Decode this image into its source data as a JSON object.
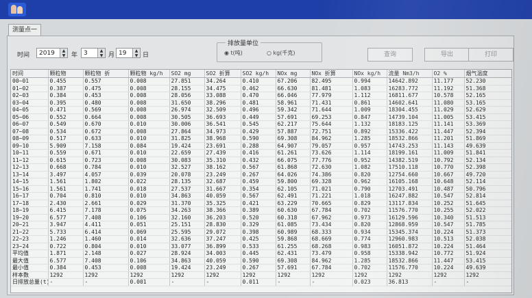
{
  "tab_label": "测量点一",
  "controls": {
    "time_label": "时间",
    "year": "2019",
    "year_unit": "年",
    "month": "3",
    "month_unit": "月",
    "day": "19",
    "day_unit": "日",
    "unit_group_title": "排放量单位",
    "unit_option_t": "t(吨)",
    "unit_option_kg": "kg(千克)",
    "selected_unit": "t(吨)",
    "query_button": "查询",
    "export_button": "导出",
    "print_button": "打印"
  },
  "table": {
    "columns": [
      "时间",
      "颗粒物",
      "颗粒物 折",
      "颗粒物 kg/h",
      "SO2 mg",
      "SO2 折算",
      "SO2 kg/h",
      "NOx mg",
      "NOx 折算",
      "NOx kg/h",
      "流量 Nm3/h",
      "O2 %",
      "烟气温度"
    ],
    "rows": [
      [
        "00~01",
        "0.455",
        "0.557",
        "0.008",
        "27.851",
        "34.264",
        "0.410",
        "67.206",
        "82.495",
        "0.994",
        "14642.892",
        "11.177",
        "52.230"
      ],
      [
        "01~02",
        "0.387",
        "0.475",
        "0.008",
        "28.155",
        "34.475",
        "0.462",
        "66.630",
        "81.481",
        "1.083",
        "16283.772",
        "11.192",
        "51.368"
      ],
      [
        "02~03",
        "0.384",
        "0.453",
        "0.008",
        "28.056",
        "33.088",
        "0.470",
        "66.046",
        "77.979",
        "1.112",
        "16811.677",
        "10.578",
        "52.165"
      ],
      [
        "03~04",
        "0.395",
        "0.480",
        "0.008",
        "31.650",
        "38.296",
        "0.481",
        "58.961",
        "71.431",
        "0.861",
        "14602.641",
        "11.080",
        "53.165"
      ],
      [
        "04~05",
        "0.471",
        "0.569",
        "0.008",
        "26.974",
        "32.509",
        "0.496",
        "59.342",
        "71.644",
        "1.009",
        "18304.455",
        "11.029",
        "52.629"
      ],
      [
        "05~06",
        "0.552",
        "0.664",
        "0.008",
        "30.505",
        "36.693",
        "0.449",
        "57.691",
        "69.253",
        "0.847",
        "14739.104",
        "11.005",
        "53.415"
      ],
      [
        "06~07",
        "0.549",
        "0.670",
        "0.010",
        "30.006",
        "36.541",
        "0.545",
        "62.217",
        "75.644",
        "1.132",
        "18183.125",
        "11.141",
        "53.369"
      ],
      [
        "07~08",
        "0.534",
        "0.672",
        "0.008",
        "27.864",
        "34.973",
        "0.429",
        "57.887",
        "72.751",
        "0.892",
        "15336.422",
        "11.447",
        "52.394"
      ],
      [
        "08~09",
        "0.517",
        "0.633",
        "0.010",
        "31.825",
        "38.968",
        "0.590",
        "69.308",
        "84.962",
        "1.285",
        "18532.866",
        "11.201",
        "51.869"
      ],
      [
        "09~10",
        "5.909",
        "7.158",
        "0.084",
        "19.424",
        "23.691",
        "0.288",
        "64.907",
        "79.057",
        "0.957",
        "14743.253",
        "11.143",
        "49.639"
      ],
      [
        "10~11",
        "0.559",
        "0.671",
        "0.010",
        "22.659",
        "27.439",
        "0.416",
        "61.261",
        "73.626",
        "1.114",
        "18199.161",
        "11.009",
        "51.841"
      ],
      [
        "11~12",
        "0.615",
        "0.723",
        "0.008",
        "30.083",
        "35.310",
        "0.432",
        "66.075",
        "77.776",
        "0.952",
        "14382.519",
        "10.792",
        "52.134"
      ],
      [
        "12~13",
        "0.668",
        "0.784",
        "0.010",
        "32.527",
        "38.162",
        "0.567",
        "61.868",
        "72.630",
        "1.082",
        "17510.118",
        "10.770",
        "52.398"
      ],
      [
        "13~14",
        "3.497",
        "4.057",
        "0.039",
        "20.078",
        "23.249",
        "0.267",
        "64.026",
        "74.386",
        "0.820",
        "12754.660",
        "10.667",
        "49.720"
      ],
      [
        "14~15",
        "1.561",
        "1.802",
        "0.022",
        "28.135",
        "32.687",
        "0.459",
        "59.800",
        "69.328",
        "0.962",
        "16105.168",
        "10.648",
        "52.114"
      ],
      [
        "15~16",
        "1.561",
        "1.741",
        "0.018",
        "27.537",
        "31.667",
        "0.354",
        "62.105",
        "71.021",
        "0.790",
        "12703.491",
        "10.487",
        "50.796"
      ],
      [
        "16~17",
        "0.704",
        "0.810",
        "0.010",
        "34.863",
        "40.059",
        "0.567",
        "62.491",
        "71.221",
        "1.018",
        "16247.882",
        "10.547",
        "52.814"
      ],
      [
        "17~18",
        "2.430",
        "2.661",
        "0.029",
        "31.370",
        "35.325",
        "0.421",
        "63.229",
        "70.665",
        "0.829",
        "13117.834",
        "10.252",
        "51.645"
      ],
      [
        "18~19",
        "6.415",
        "7.178",
        "0.075",
        "34.263",
        "38.366",
        "0.389",
        "60.630",
        "67.784",
        "0.702",
        "11576.770",
        "10.255",
        "52.022"
      ],
      [
        "19~20",
        "6.577",
        "7.408",
        "0.106",
        "32.160",
        "36.203",
        "0.520",
        "60.318",
        "67.962",
        "0.973",
        "16129.596",
        "10.340",
        "51.513"
      ],
      [
        "20~21",
        "3.947",
        "4.411",
        "0.051",
        "25.151",
        "28.830",
        "0.329",
        "61.085",
        "73.434",
        "0.820",
        "12868.959",
        "10.547",
        "51.785"
      ],
      [
        "21~22",
        "5.733",
        "6.414",
        "0.069",
        "25.595",
        "29.072",
        "0.398",
        "60.989",
        "68.333",
        "0.934",
        "15345.374",
        "10.224",
        "51.373"
      ],
      [
        "22~23",
        "1.246",
        "1.460",
        "0.014",
        "32.636",
        "37.247",
        "0.425",
        "59.868",
        "68.669",
        "0.774",
        "12960.983",
        "10.513",
        "52.038"
      ],
      [
        "23~24",
        "0.722",
        "0.804",
        "0.010",
        "33.077",
        "36.899",
        "0.533",
        "61.255",
        "68.268",
        "0.983",
        "16051.872",
        "10.224",
        "51.464"
      ],
      [
        "平均值",
        "1.871",
        "2.148",
        "0.027",
        "28.924",
        "34.003",
        "0.445",
        "62.431",
        "73.479",
        "0.958",
        "15338.942",
        "10.772",
        "51.924"
      ],
      [
        "最大值",
        "6.577",
        "7.408",
        "0.106",
        "34.863",
        "40.059",
        "0.590",
        "69.308",
        "84.962",
        "1.285",
        "18532.866",
        "11.447",
        "53.415"
      ],
      [
        "最小值",
        "0.384",
        "0.453",
        "0.008",
        "19.424",
        "23.249",
        "0.267",
        "57.691",
        "67.784",
        "0.702",
        "11576.770",
        "10.224",
        "49.639"
      ],
      [
        "样本数",
        "1292",
        "1292",
        "1292",
        "1292",
        "1292",
        "1292",
        "1292",
        "1292",
        "1292",
        "1292",
        "1292",
        "1292"
      ],
      [
        "日排放总量(t)",
        "-",
        "-",
        "0.001",
        "-",
        "-",
        "0.011",
        "-",
        "-",
        "0.023",
        "36.813",
        "-",
        "-"
      ]
    ]
  }
}
